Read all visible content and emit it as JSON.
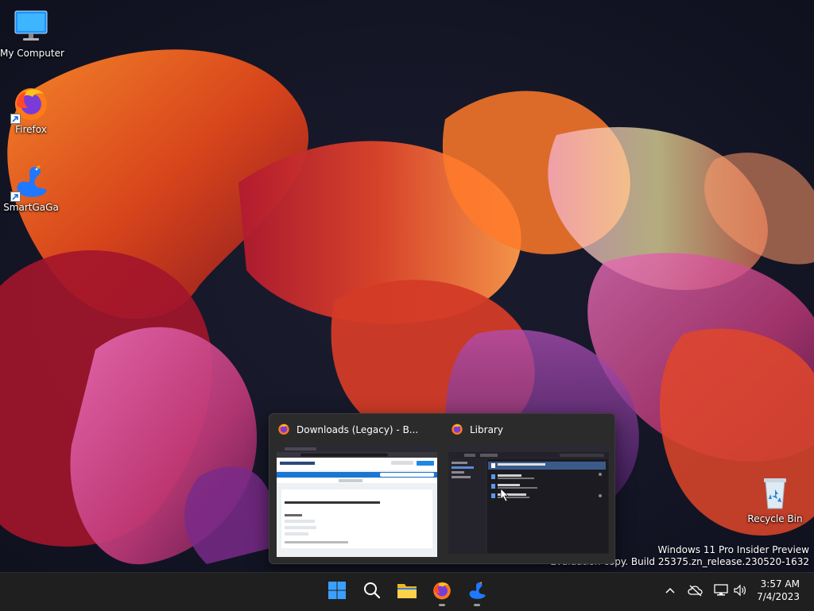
{
  "desktop": {
    "icons": [
      {
        "label": "My Computer",
        "icon": "monitor-icon"
      },
      {
        "label": "Firefox",
        "icon": "firefox-icon"
      },
      {
        "label": "SmartGaGa",
        "icon": "smartgaga-icon"
      },
      {
        "label": "Recycle Bin",
        "icon": "recycle-bin-icon"
      }
    ]
  },
  "watermark": {
    "line1": "Windows 11 Pro Insider Preview",
    "line2": "Evaluation copy. Build 25375.zn_release.230520-1632"
  },
  "thumbnails": [
    {
      "title": "Downloads (Legacy) - B...",
      "icon": "firefox-icon"
    },
    {
      "title": "Library",
      "icon": "firefox-icon"
    }
  ],
  "taskbar": {
    "buttons": [
      "start-icon",
      "search-icon",
      "file-explorer-icon",
      "firefox-icon",
      "smartgaga-icon"
    ],
    "tray": [
      "chevron-up-icon",
      "cloud-off-icon",
      "network-icon",
      "speaker-icon"
    ],
    "clock": {
      "time": "3:57 AM",
      "date": "7/4/2023"
    }
  },
  "colors": {
    "taskbar_bg": "#1f1f1f",
    "accent_blue": "#0a84ff",
    "folder_yellow": "#f2b624"
  }
}
